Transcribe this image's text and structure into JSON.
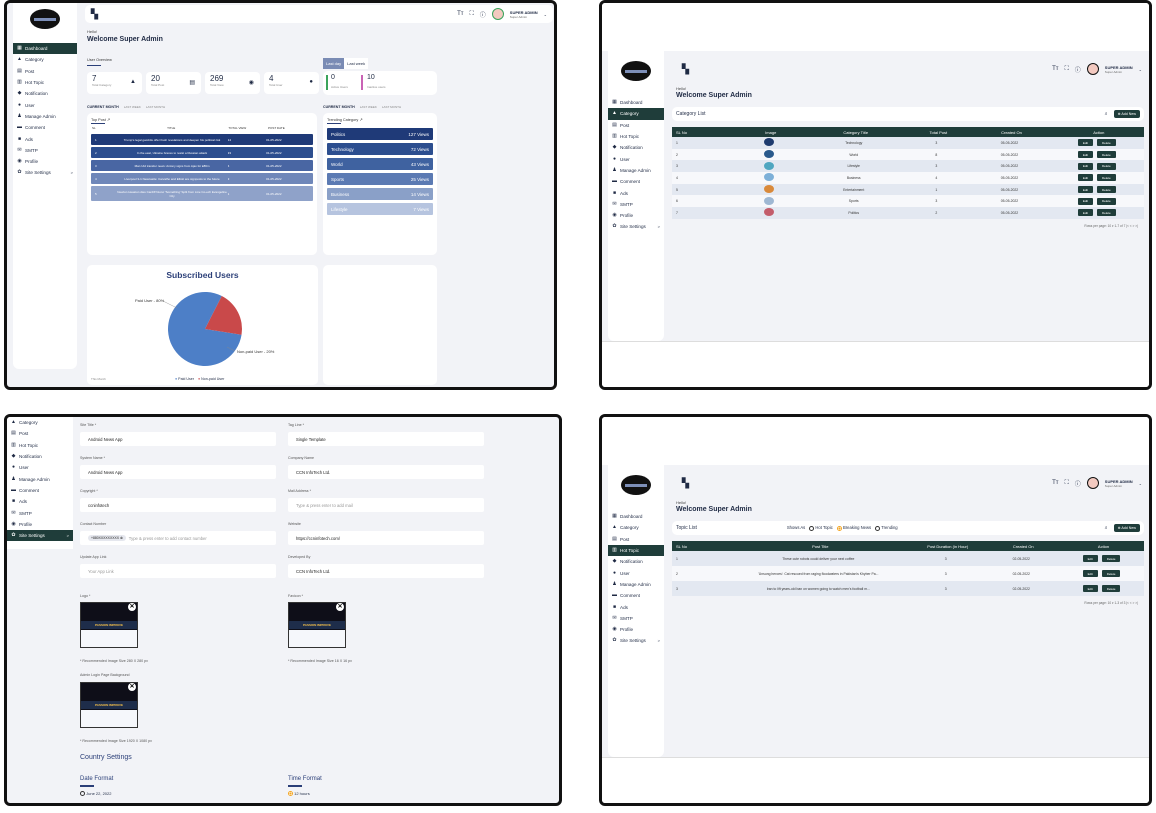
{
  "shared": {
    "admin_name": "SUPER ADMIN",
    "admin_role": "Super Admin",
    "hello": "Hello!",
    "welcome": "Welcome Super Admin",
    "text_size_icon": "Tт",
    "nav": [
      {
        "label": "Dashboard",
        "icon": "▦"
      },
      {
        "label": "Category",
        "icon": "▲"
      },
      {
        "label": "Post",
        "icon": "▤"
      },
      {
        "label": "Hot Topic",
        "icon": "▥"
      },
      {
        "label": "Notification",
        "icon": "◆"
      },
      {
        "label": "User",
        "icon": "●"
      },
      {
        "label": "Manage Admin",
        "icon": "♟"
      },
      {
        "label": "Comment",
        "icon": "▬"
      },
      {
        "label": "Ads",
        "icon": "■"
      },
      {
        "label": "SMTP",
        "icon": "✉"
      },
      {
        "label": "Profile",
        "icon": "◉"
      },
      {
        "label": "Site Settings",
        "icon": "✿"
      }
    ],
    "nav_arrow": ">"
  },
  "dashboard": {
    "user_overview": "User Overview",
    "stats": [
      {
        "num": "7",
        "label": "Total Category",
        "icon": "▲"
      },
      {
        "num": "20",
        "label": "Total Post",
        "icon": "▤"
      },
      {
        "num": "269",
        "label": "Total View",
        "icon": "◉"
      },
      {
        "num": "4",
        "label": "Total User",
        "icon": "●"
      }
    ],
    "tabs": [
      "Last day",
      "Last week"
    ],
    "side_stats": [
      {
        "num": "0",
        "label": "Active Users"
      },
      {
        "num": "10",
        "label": "Inactive users"
      }
    ],
    "period_left": [
      "CURRENT MONTH",
      "LAST WEEK",
      "LAST MONTH"
    ],
    "period_right": [
      "CURRENT MONTH",
      "LAST WEEK",
      "LAST MONTH"
    ],
    "top_post": "Top Post",
    "trending": "Trending Category",
    "post_columns": [
      "SL",
      "TITLE",
      "TOTAL VIEW",
      "POST DATE"
    ],
    "posts": [
      {
        "sl": "1",
        "title": "Trump's legal gambits offer fresh revelations and deepen his political risk",
        "views": "14",
        "date": "01-05-2022"
      },
      {
        "sl": "2",
        "title": "In the east, Ukraine braces to resist a Russian attack",
        "views": "33",
        "date": "01-05-2022"
      },
      {
        "sl": "3",
        "title": "Man Utd transfer news: Antony signs from Ajax for £86m",
        "views": "4",
        "date": "01-05-2022"
      },
      {
        "sl": "4",
        "title": "Liverpool 3-1 Newcastle: Carvalho and Elliott are signposts to the future",
        "views": "3",
        "date": "01-05-2022"
      },
      {
        "sl": "5",
        "title": "Newton Heaston dies Cardiff Nucur 'Something' Split from Line Co-ech Evangeline City",
        "views": "1",
        "date": "01-05-2022"
      }
    ],
    "trending_rows": [
      {
        "name": "Politics",
        "views": "127 Views",
        "color": "#1f3a78"
      },
      {
        "name": "Technology",
        "views": "72 Views",
        "color": "#2c4e8f"
      },
      {
        "name": "World",
        "views": "43 Views",
        "color": "#3f62a0"
      },
      {
        "name": "Sports",
        "views": "25 Views",
        "color": "#5b7ab3"
      },
      {
        "name": "Business",
        "views": "14 Views",
        "color": "#8aa0c8"
      },
      {
        "name": "Lifestyle",
        "views": "7 Views",
        "color": "#b6c4df"
      }
    ],
    "subscribed_title": "Subscribed Users",
    "pie_labels": {
      "paid": "Paid User - 80%",
      "nonpaid": "Non-paid User - 20%"
    },
    "legend": [
      "Paid User",
      "Non-paid User"
    ],
    "pie_corner": "This Month"
  },
  "chart_data": {
    "type": "pie",
    "title": "Subscribed Users",
    "categories": [
      "Paid User",
      "Non-paid User"
    ],
    "values": [
      80,
      20
    ],
    "colors": [
      "#4d7fc7",
      "#c9494a"
    ],
    "legend_position": "bottom"
  },
  "category": {
    "title": "Category List",
    "add_new": "Add New",
    "columns": [
      "SL No",
      "Image",
      "Category Title",
      "Total Post",
      "Created On",
      "Action"
    ],
    "rows": [
      {
        "sl": "1",
        "title": "Technology",
        "posts": "3",
        "created": "05-05-2022",
        "color": "#1e3b6e"
      },
      {
        "sl": "2",
        "title": "World",
        "posts": "8",
        "created": "05-05-2022",
        "color": "#2a5a8c"
      },
      {
        "sl": "3",
        "title": "Lifestyle",
        "posts": "3",
        "created": "05-05-2022",
        "color": "#4fa6c0"
      },
      {
        "sl": "4",
        "title": "Business",
        "posts": "4",
        "created": "05-05-2022",
        "color": "#7db0d8"
      },
      {
        "sl": "5",
        "title": "Entertainment",
        "posts": "1",
        "created": "05-05-2022",
        "color": "#d9893a"
      },
      {
        "sl": "6",
        "title": "Sports",
        "posts": "3",
        "created": "05-05-2022",
        "color": "#9fb8d3"
      },
      {
        "sl": "7",
        "title": "Politics",
        "posts": "2",
        "created": "05-05-2022",
        "color": "#c35d6b"
      }
    ],
    "edit": "Edit",
    "delete": "Delete",
    "pagination": "Rows per page:  10 ▾     1-7 of 7      |<   <   >   >|"
  },
  "settings": {
    "fields": [
      {
        "label": "Site Title *",
        "value": "Android News App"
      },
      {
        "label": "Tag Line *",
        "value": "Single Template"
      },
      {
        "label": "System Name *",
        "value": "Android News App"
      },
      {
        "label": "Company Name",
        "value": "CCN InfoTech Ltd."
      },
      {
        "label": "Copyright *",
        "value": "ccninfotech"
      },
      {
        "label": "Mail Address *",
        "value": "Type & press enter to add mail"
      },
      {
        "label": "Contact Number",
        "value": "Type & press enter to add contact number"
      },
      {
        "label": "Website",
        "value": "https://ccninfotech.com/"
      },
      {
        "label": "Update App Link",
        "value": "Your App Link"
      },
      {
        "label": "Developed By",
        "value": "CCN InfoTech Ltd."
      }
    ],
    "contact_chip": "+880XXXXXXXXX",
    "logo_label": "Logo *",
    "favicon_label": "Favicon *",
    "logo_rec": "* Recommended Image Size 280 X 280 px",
    "favicon_rec": "* Recommended Image Size 16 X 16 px",
    "login_bg_label": "Admin Login Page Background",
    "login_bg_rec": "* Recommended Image Size 1920 X 1080 px",
    "preview_text": "PASSION IMPROVE",
    "country_settings": "Country Settings",
    "date_format": "Date Format",
    "time_format": "Time Format",
    "date_option": "June 22, 2022",
    "time_option": "12 hours"
  },
  "topic": {
    "title": "Topic List",
    "show_as": "Shows As",
    "options": [
      "Hot Topic",
      "Breaking News",
      "Trending"
    ],
    "add_new": "Add New",
    "columns": [
      "SL No",
      "Post Title",
      "Post Duration (in Hour)",
      "Created On",
      "Action"
    ],
    "rows": [
      {
        "sl": "1",
        "title": "These cute robots could deliver your next coffee",
        "dur": "3",
        "created": "02-05-2022"
      },
      {
        "sl": "2",
        "title": "'Unsung heroes': Cat rescued from raging floodwaters in Pakistan's Khyber Pa...",
        "dur": "3",
        "created": "02-05-2022"
      },
      {
        "sl": "3",
        "title": "Iran to lift years-old ban on women going to watch men's football m...",
        "dur": "3",
        "created": "02-05-2022"
      }
    ],
    "edit": "Edit",
    "delete": "Delete",
    "pagination": "Rows per page:  10 ▾     1-3 of 3      |<   <   >   >|"
  }
}
